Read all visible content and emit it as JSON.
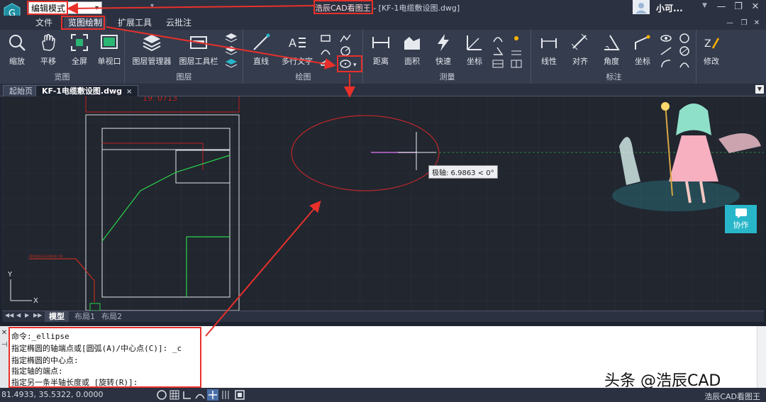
{
  "titlebar": {
    "mode": "编辑模式",
    "app_name": "浩辰CAD看图王",
    "doc_title": "- [KF-1电缆敷设图.dwg]",
    "user_name": "小可...",
    "minimize": "—",
    "maximize": "❐",
    "close": "✕"
  },
  "menubar": {
    "tabs": [
      {
        "label": "文件"
      },
      {
        "label": "览图绘制",
        "active": true
      },
      {
        "label": "扩展工具"
      },
      {
        "label": "云批注"
      }
    ]
  },
  "ribbon": {
    "groups": [
      {
        "label": "览图",
        "buttons": [
          "缩放",
          "平移",
          "全屏",
          "单视口"
        ]
      },
      {
        "label": "图层",
        "buttons": [
          "图层管理器",
          "图层工具栏"
        ]
      },
      {
        "label": "绘图",
        "buttons": [
          "直线",
          "多行文字"
        ]
      },
      {
        "label": "测量",
        "buttons": [
          "距离",
          "面积",
          "快速",
          "坐标"
        ]
      },
      {
        "label": "标注",
        "buttons": [
          "线性",
          "对齐",
          "角度",
          "坐标"
        ]
      },
      {
        "label": "",
        "buttons": [
          "修改"
        ]
      }
    ]
  },
  "tabs": {
    "start": "起始页",
    "document": "KF-1电缆敷设图.dwg",
    "close": "×"
  },
  "canvas": {
    "tooltip": "极轴: 6.9863 < 0°",
    "dim_text": "19. 0713",
    "red_label": "ZR-YJV22-0.6/1KV-4×16",
    "axis_x": "X",
    "axis_y": "Y",
    "collab_label": "协作"
  },
  "layout_tabs": {
    "nav": [
      "◀◀",
      "◀",
      "▶",
      "▶▶"
    ],
    "tabs": [
      "模型",
      "布局1",
      "布局2"
    ]
  },
  "command": {
    "lines": [
      "命令:_ellipse",
      "指定椭圆的轴端点或[圆弧(A)/中心点(C)]: _c",
      "指定椭圆的中心点:",
      "指定轴的端点:",
      "指定另一条半轴长度或 [旋转(R)]:"
    ],
    "side_label": "✕"
  },
  "status": {
    "coords": "81.4933, 35.5322, 0.0000",
    "app": "浩辰CAD看图王"
  },
  "watermark": "头条 @浩辰CAD",
  "colors": {
    "annotation_red": "#e8302b",
    "canvas_bg": "#21262f",
    "ribbon_bg": "#353c4d",
    "accent_cyan": "#28b6c9"
  }
}
